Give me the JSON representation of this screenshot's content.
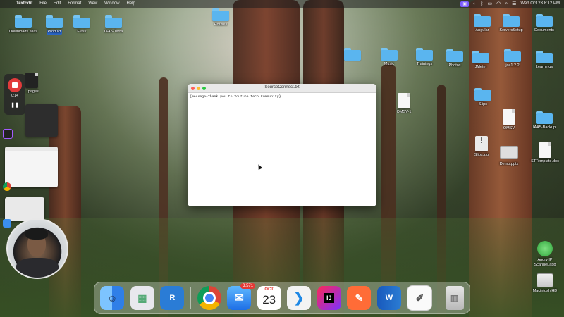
{
  "menubar": {
    "apple": "",
    "app_name": "TextEdit",
    "menus": [
      "File",
      "Edit",
      "Format",
      "View",
      "Window",
      "Help"
    ],
    "clock": "Wed Oct 23  8:12 PM"
  },
  "desktop": {
    "icons": {
      "downloads_alias": "Downloads alias",
      "product": "Product",
      "flask": "Flask",
      "iaa_terra": "IAA5-Terra",
      "houses": "Houses",
      "angular": "Angular",
      "servers_setup": "ServersSetup",
      "documents": "Documents",
      "music": "Music",
      "trainings": "Trainings",
      "photos": "Photos",
      "jmeter": "JMeter",
      "jce": "jce1.2.2",
      "learnings": "Learnings",
      "slips": "Slips",
      "omsv_doc": "OMSV-1",
      "omsv": "OMSV",
      "iaa_backup": "IAA5-Backup",
      "slips_zip": "Slips.zip",
      "demo_pptx": "Demo.pptx",
      "st_template": "STTemplate.doc",
      "angry_ip": "Angry IP Scanner.app",
      "macintosh_hd": "Macintosh HD",
      "pages": "...pages"
    }
  },
  "recording": {
    "time": "0:14",
    "pause": "❚❚"
  },
  "textedit": {
    "title": "SourceConnect.txt",
    "content": "{message=Thank you to Youtube Tech Community}"
  },
  "dock": {
    "apps": {
      "finder": "Finder",
      "launchpad": "Launchpad",
      "vnc": "VNC",
      "chrome": "Chrome",
      "mail": "Mail",
      "mail_badge": "3,571",
      "calendar_month": "OCT",
      "calendar_day": "23",
      "vscode": "VS Code",
      "intellij": "IJ",
      "postman": "Postman",
      "word": "W",
      "textedit": "TextEdit",
      "trash": "Trash"
    }
  },
  "colors": {
    "folder": "#5ab5ef",
    "record": "#e23b3b",
    "selection": "#2b66c7"
  }
}
